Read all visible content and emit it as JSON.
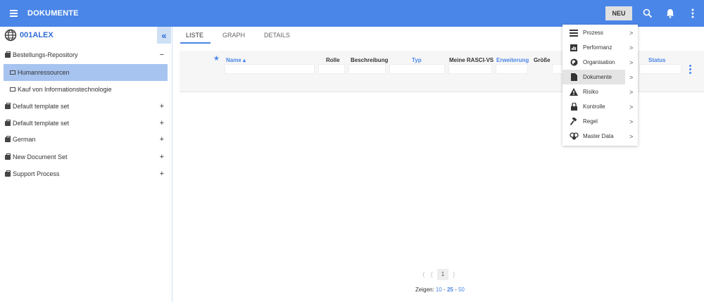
{
  "header": {
    "title": "DOKUMENTE",
    "new_button": "NEU"
  },
  "sidebar": {
    "root": "001ALEX",
    "collapse_label": "«",
    "items": [
      {
        "label": "Bestellungs-Repository",
        "type": "set",
        "symbol": "−"
      },
      {
        "label": "Humanressourcen",
        "type": "folder",
        "symbol": ""
      },
      {
        "label": "Kauf von Informationstechnologie",
        "type": "folder",
        "symbol": ""
      },
      {
        "label": "Default template set",
        "type": "set",
        "symbol": "+"
      },
      {
        "label": "Default template set",
        "type": "set",
        "symbol": "+"
      },
      {
        "label": "German",
        "type": "set",
        "symbol": "+"
      },
      {
        "label": "New Document Set",
        "type": "set",
        "symbol": "+"
      },
      {
        "label": "Support Process",
        "type": "set",
        "symbol": "+"
      }
    ]
  },
  "tabs": [
    {
      "label": "LISTE"
    },
    {
      "label": "GRAPH"
    },
    {
      "label": "DETAILS"
    }
  ],
  "table": {
    "columns": {
      "name": "Name ▴",
      "rolle": "Rolle",
      "beschreibung": "Beschreibung",
      "typ": "Typ",
      "rasci": "Meine RASCI-VS",
      "erweiterung": "Erweiterung",
      "groesse": "Größe",
      "status": "Status"
    }
  },
  "pagination": {
    "prev_first": "⟨",
    "prev": "⟨",
    "page": "1",
    "next": "⟩",
    "show_label": "Zeigen:",
    "opt_10": "10",
    "sep1": " - ",
    "opt_25": "25",
    "sep2": " - ",
    "opt_50": "50"
  },
  "dropdown": {
    "items": [
      {
        "label": "Prozess",
        "icon": "process-icon"
      },
      {
        "label": "Performanz",
        "icon": "performance-icon"
      },
      {
        "label": "Organisation",
        "icon": "organisation-icon"
      },
      {
        "label": "Dokumente",
        "icon": "document-icon"
      },
      {
        "label": "Risiko",
        "icon": "risk-icon"
      },
      {
        "label": "Kontrolle",
        "icon": "control-icon"
      },
      {
        "label": "Regel",
        "icon": "rule-icon"
      },
      {
        "label": "Master Data",
        "icon": "master-data-icon"
      }
    ]
  },
  "colors": {
    "accent": "#4a86e8",
    "selected_row": "#a7c4f0"
  }
}
